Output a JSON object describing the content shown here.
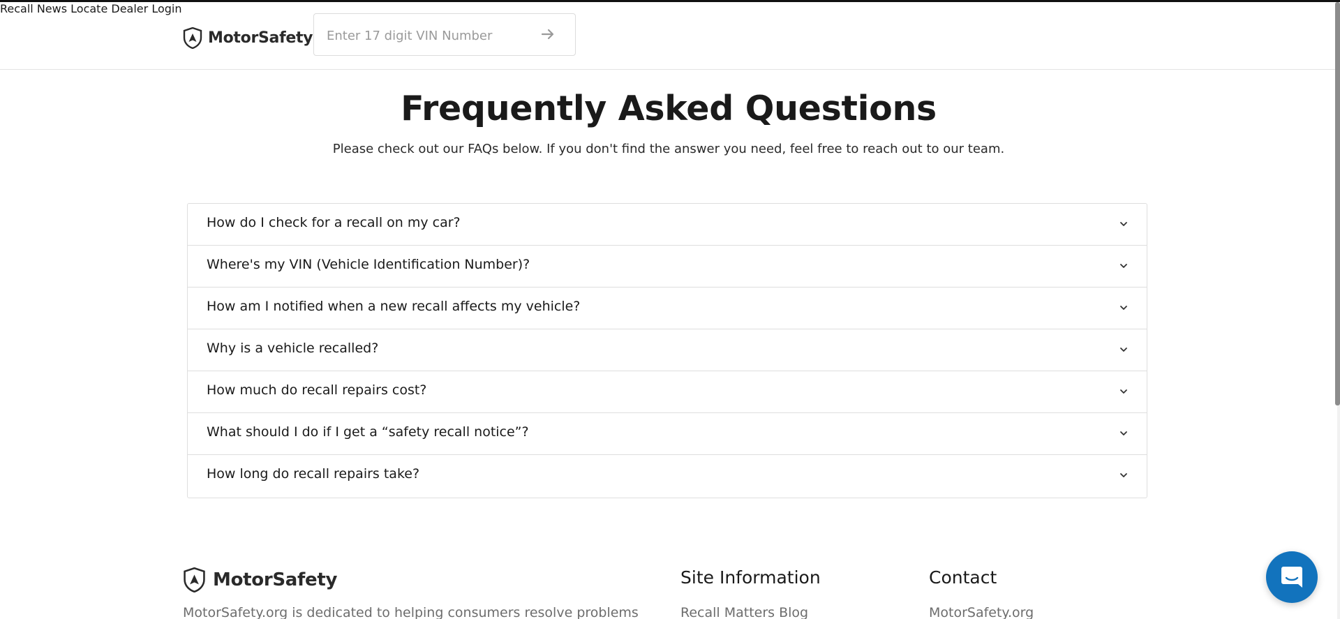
{
  "header": {
    "brand": "MotorSafety",
    "vin_placeholder": "Enter 17 digit VIN Number",
    "nav": [
      {
        "label": "Recall News"
      },
      {
        "label": "Locate Dealer"
      },
      {
        "label": "Login"
      }
    ]
  },
  "hero": {
    "title": "Frequently Asked Questions",
    "subtitle": "Please check out our FAQs below. If you don't find the answer you need, feel free to reach out to our team."
  },
  "faq": [
    {
      "question": "How do I check for a recall on my car?"
    },
    {
      "question": "Where's my VIN (Vehicle Identification Number)?"
    },
    {
      "question": "How am I notified when a new recall affects my vehicle?"
    },
    {
      "question": "Why is a vehicle recalled?"
    },
    {
      "question": "How much do recall repairs cost?"
    },
    {
      "question": "What should I do if I get a “safety recall notice”?"
    },
    {
      "question": "How long do recall repairs take?"
    }
  ],
  "footer": {
    "brand": "MotorSafety",
    "description": "MotorSafety.org is dedicated to helping consumers resolve problems",
    "site_info": {
      "heading": "Site Information",
      "links": [
        "Recall Matters Blog"
      ]
    },
    "contact": {
      "heading": "Contact",
      "links": [
        "MotorSafety.org"
      ]
    }
  },
  "colors": {
    "chat_button": "#1273bd",
    "text_primary": "#1a1a1a",
    "text_muted": "#6d6d6d"
  },
  "icons": {
    "logo": "shield-icon",
    "vin_submit": "arrow-right-icon",
    "faq_toggle": "chevron-down-icon",
    "chat": "chat-bubble-icon"
  }
}
